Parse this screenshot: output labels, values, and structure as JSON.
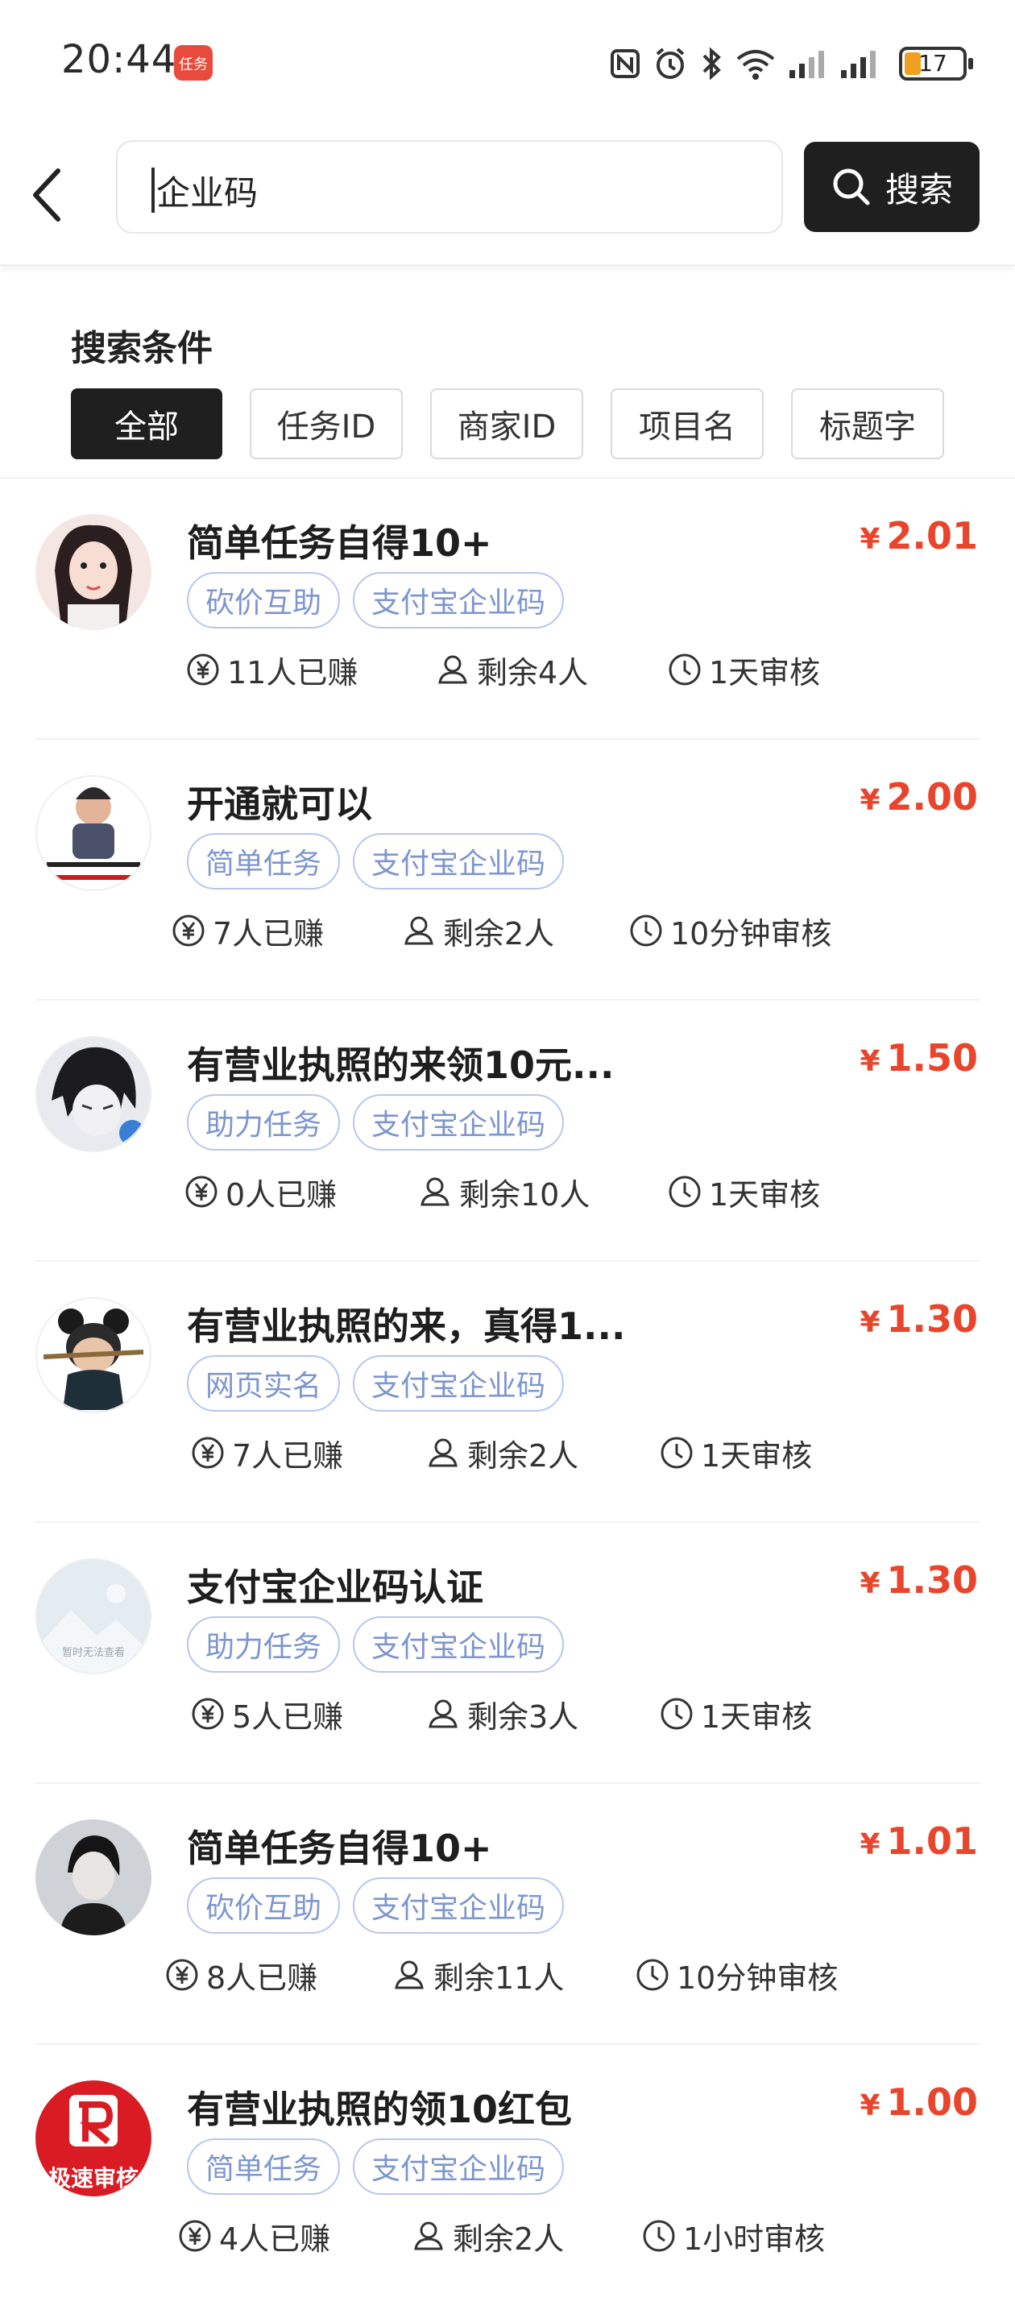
{
  "status_bar": {
    "time": "20:44",
    "app_badge_text": "任务",
    "battery": "17",
    "icons": [
      "nfc-icon",
      "alarm-icon",
      "bluetooth-icon",
      "wifi-icon",
      "signal-icon",
      "signal-icon",
      "battery-icon"
    ]
  },
  "search": {
    "back_icon": "chevron-left-icon",
    "query": "企业码",
    "button_label": "搜索"
  },
  "filters": {
    "title": "搜索条件",
    "chips": [
      "全部",
      "任务ID",
      "商家ID",
      "项目名",
      "标题字"
    ],
    "active_index": 0
  },
  "tasks": [
    {
      "title": "简单任务自得10+",
      "price": "2.01",
      "currency": "¥",
      "tags": [
        "砍价互助",
        "支付宝企业码"
      ],
      "earned": "11人已赚",
      "remaining": "剩余4人",
      "review": "1天审核",
      "avatar": "avatar-girl"
    },
    {
      "title": "开通就可以",
      "price": "2.00",
      "currency": "¥",
      "tags": [
        "简单任务",
        "支付宝企业码"
      ],
      "earned": "7人已赚",
      "remaining": "剩余2人",
      "review": "10分钟审核",
      "avatar": "avatar-meme"
    },
    {
      "title": "有营业执照的来领10元...",
      "price": "1.50",
      "currency": "¥",
      "tags": [
        "助力任务",
        "支付宝企业码"
      ],
      "earned": "0人已赚",
      "remaining": "剩余10人",
      "review": "1天审核",
      "avatar": "avatar-anime"
    },
    {
      "title": "有营业执照的来，真得1...",
      "price": "1.30",
      "currency": "¥",
      "tags": [
        "网页实名",
        "支付宝企业码"
      ],
      "earned": "7人已赚",
      "remaining": "剩余2人",
      "review": "1天审核",
      "avatar": "avatar-doll"
    },
    {
      "title": "支付宝企业码认证",
      "price": "1.30",
      "currency": "¥",
      "tags": [
        "助力任务",
        "支付宝企业码"
      ],
      "earned": "5人已赚",
      "remaining": "剩余3人",
      "review": "1天审核",
      "avatar": "avatar-placeholder",
      "avatar_text": "暂时无法查看"
    },
    {
      "title": "简单任务自得10+",
      "price": "1.01",
      "currency": "¥",
      "tags": [
        "砍价互助",
        "支付宝企业码"
      ],
      "earned": "8人已赚",
      "remaining": "剩余11人",
      "review": "10分钟审核",
      "avatar": "avatar-boy"
    },
    {
      "title": "有营业执照的领10红包",
      "price": "1.00",
      "currency": "¥",
      "tags": [
        "简单任务",
        "支付宝企业码"
      ],
      "earned": "4人已赚",
      "remaining": "剩余2人",
      "review": "1小时审核",
      "avatar": "avatar-logo",
      "avatar_text": "极速审核"
    }
  ],
  "colors": {
    "price": "#e8452c",
    "tag_border": "#b7c7ea",
    "tag_text": "#7d96cf",
    "dark_button": "#1f1f1f"
  }
}
